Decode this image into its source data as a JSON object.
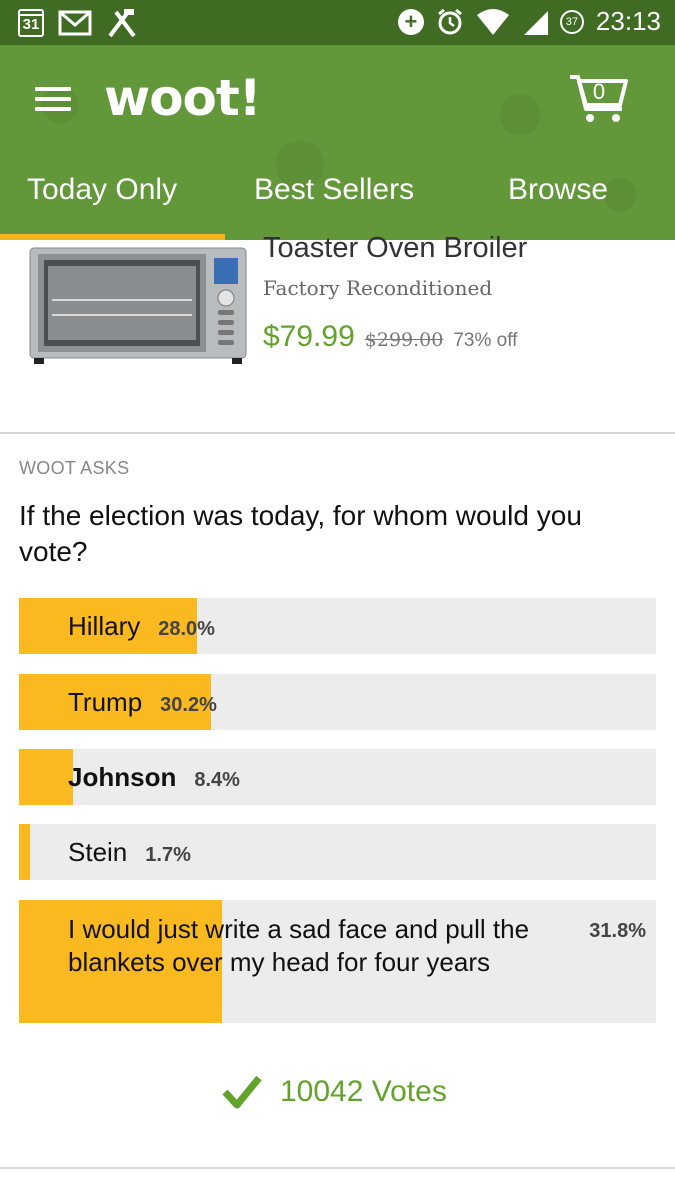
{
  "status_bar": {
    "calendar_day": "31",
    "battery_level": "37",
    "time": "23:13",
    "icons": [
      "calendar-icon",
      "gmail-icon",
      "tools-icon",
      "data-saver-icon",
      "alarm-icon",
      "wifi-icon",
      "signal-icon",
      "battery-icon"
    ]
  },
  "app_bar": {
    "logo": "woot!",
    "cart_count": "0",
    "tabs": [
      {
        "label": "Today Only",
        "selected": true
      },
      {
        "label": "Best Sellers",
        "selected": false
      },
      {
        "label": "Browse",
        "selected": false
      }
    ],
    "colors": {
      "bar": "#62973a",
      "status": "#3f6b23",
      "indicator": "#f6b51e"
    }
  },
  "product": {
    "title": "Toaster Oven Broiler",
    "condition": "Factory Reconditioned",
    "price": "$79.99",
    "original_price": "$299.00",
    "discount": "73% off"
  },
  "poll": {
    "section_label": "WOOT ASKS",
    "question": "If the election was today, for whom would you vote?",
    "options": [
      {
        "label": "Hillary",
        "percent_text": "28.0%",
        "percent": 28.0
      },
      {
        "label": "Trump",
        "percent_text": "30.2%",
        "percent": 30.2
      },
      {
        "label": "Johnson",
        "percent_text": "8.4%",
        "percent": 8.4
      },
      {
        "label": "Stein",
        "percent_text": "1.7%",
        "percent": 1.7
      },
      {
        "label": "I would just write a sad face and pull the blankets over my head for four years",
        "percent_text": "31.8%",
        "percent": 31.8
      }
    ],
    "votes": "10042 Votes",
    "colors": {
      "fill": "#f9b91f",
      "track": "#ececec",
      "accent": "#62a32c"
    }
  }
}
